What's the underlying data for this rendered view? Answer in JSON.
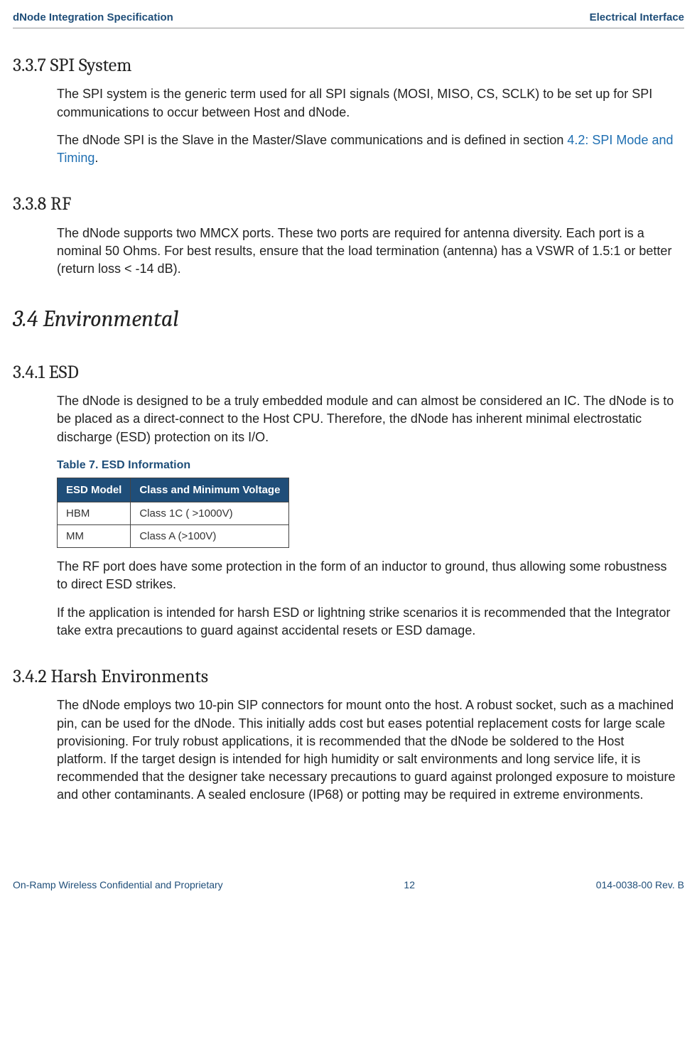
{
  "header": {
    "left": "dNode Integration Specification",
    "right": "Electrical Interface"
  },
  "footer": {
    "left": "On-Ramp Wireless Confidential and Proprietary",
    "center": "12",
    "right": "014-0038-00 Rev. B"
  },
  "sections": {
    "s337": {
      "heading": "3.3.7 SPI System",
      "p1": "The SPI system is the generic term used for all SPI signals (MOSI, MISO, CS, SCLK) to be set up for SPI communications to occur between Host and dNode.",
      "p2a": "The dNode SPI is the Slave in the Master/Slave communications and is defined in section ",
      "p2link": "4.2: SPI Mode and Timing",
      "p2b": "."
    },
    "s338": {
      "heading": "3.3.8 RF",
      "p1": "The dNode supports two MMCX ports. These two ports are required for antenna diversity. Each port is a nominal 50 Ohms. For best results, ensure that the load termination (antenna) has a VSWR of 1.5:1 or better (return loss < -14 dB)."
    },
    "s34": {
      "heading": "3.4 Environmental"
    },
    "s341": {
      "heading": "3.4.1 ESD",
      "p1": "The dNode is designed to be a truly embedded module and can almost be considered an IC. The dNode is to be placed as a direct-connect to the Host CPU. Therefore, the dNode has inherent minimal electrostatic discharge (ESD) protection on its I/O.",
      "tableTitle": "Table 7. ESD Information",
      "table": {
        "headers": [
          "ESD Model",
          "Class and Minimum Voltage"
        ],
        "rows": [
          [
            "HBM",
            "Class 1C ( >1000V)"
          ],
          [
            "MM",
            "Class A (>100V)"
          ]
        ]
      },
      "p2": "The RF port does have some protection in the form of an inductor to ground, thus allowing some robustness to direct ESD strikes.",
      "p3": "If the application is intended for harsh ESD or lightning strike scenarios it is recommended that the Integrator take extra precautions to guard against accidental resets or ESD damage."
    },
    "s342": {
      "heading": "3.4.2 Harsh Environments",
      "p1": "The dNode employs two 10-pin SIP connectors for mount onto the host. A robust socket, such as a machined pin, can be used for the dNode. This initially adds cost but eases potential replacement costs for large scale provisioning. For truly robust applications, it is recommended that the dNode be soldered to the Host platform. If the target design is intended for high humidity or salt environments and long service life, it is recommended that the designer take necessary precautions to guard against prolonged exposure to moisture and other contaminants. A sealed enclosure (IP68) or potting may be required in extreme environments."
    }
  }
}
